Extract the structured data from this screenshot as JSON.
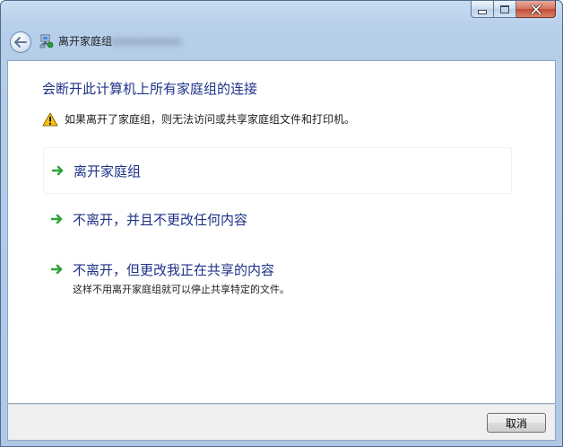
{
  "window": {
    "title": "离开家庭组",
    "caption_buttons": {
      "minimize": "minimize-icon",
      "maximize": "maximize-icon",
      "close": "close-icon"
    }
  },
  "nav": {
    "back_icon": "back-arrow-icon",
    "app_icon": "homegroup-icon"
  },
  "content": {
    "heading": "会断开此计算机上所有家庭组的连接",
    "warning": {
      "icon": "warning-icon",
      "text": "如果离开了家庭组，则无法访问或共享家庭组文件和打印机。"
    },
    "options": [
      {
        "icon": "green-arrow-icon",
        "title": "离开家庭组",
        "subtitle": ""
      },
      {
        "icon": "green-arrow-icon",
        "title": "不离开，并且不更改任何内容",
        "subtitle": ""
      },
      {
        "icon": "green-arrow-icon",
        "title": "不离开，但更改我正在共享的内容",
        "subtitle": "这样不用离开家庭组就可以停止共享特定的文件。"
      }
    ]
  },
  "footer": {
    "cancel_label": "取消"
  },
  "colors": {
    "link_blue": "#1e3287",
    "arrow_green": "#2ea33a",
    "warning_yellow": "#f5c211"
  }
}
